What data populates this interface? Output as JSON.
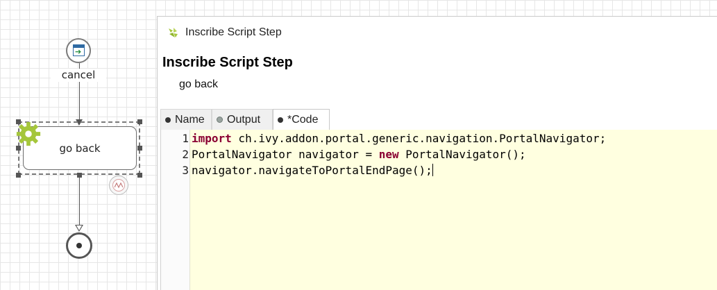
{
  "diagram": {
    "start_event": {
      "label": "cancel",
      "icon": "screen-arrow-icon"
    },
    "script_task": {
      "label": "go back",
      "icon": "gear-icon",
      "accent_color": "#a5c63b"
    },
    "boundary_event": {
      "icon": "timer-icon"
    },
    "end_event": {
      "icon": "end-event-icon"
    }
  },
  "dialog": {
    "window_title": "Inscribe Script Step",
    "header_title": "Inscribe Script Step",
    "header_subtitle": "go back",
    "tabs": [
      {
        "label": "Name",
        "active": false
      },
      {
        "label": "Output",
        "active": false
      },
      {
        "label": "*Code",
        "active": true
      }
    ],
    "code": {
      "line_numbers": [
        "1",
        "2",
        "3"
      ],
      "lines": [
        {
          "kw": "import",
          "rest": " ch.ivy.addon.portal.generic.navigation.PortalNavigator;"
        },
        {
          "pre": "PortalNavigator navigator = ",
          "kw": "new",
          "rest": " PortalNavigator();"
        },
        {
          "text": "navigator.navigateToPortalEndPage();"
        }
      ],
      "background_color": "#ffffe0",
      "keyword_color": "#8a0032"
    }
  }
}
